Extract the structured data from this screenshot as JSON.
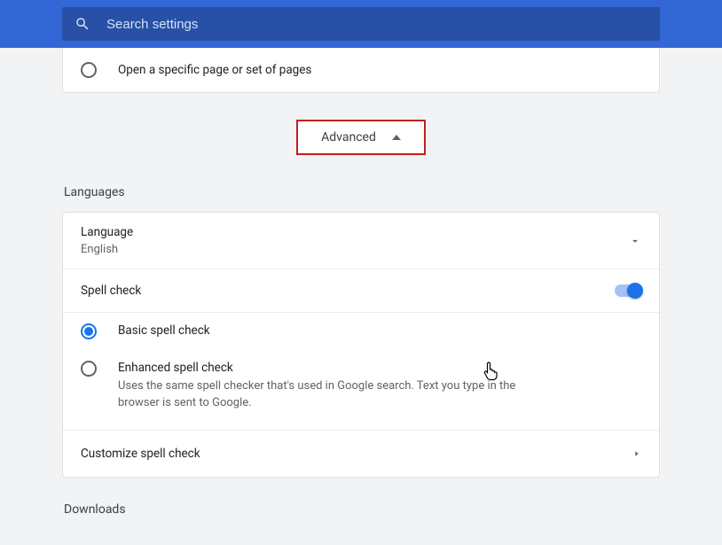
{
  "search": {
    "placeholder": "Search settings"
  },
  "startup": {
    "open_specific": "Open a specific page or set of pages"
  },
  "advanced_label": "Advanced",
  "languages_section": "Languages",
  "language": {
    "title": "Language",
    "value": "English"
  },
  "spellcheck": {
    "title": "Spell check",
    "basic": "Basic spell check",
    "enhanced": "Enhanced spell check",
    "enhanced_desc": "Uses the same spell checker that's used in Google search. Text you type in the browser is sent to Google.",
    "customize": "Customize spell check"
  },
  "downloads_section": "Downloads"
}
